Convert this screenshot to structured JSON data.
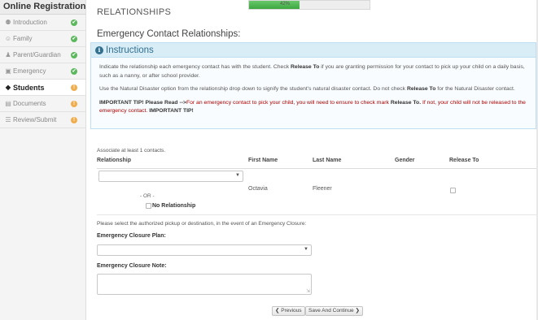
{
  "sidebar": {
    "title": "Online Registration",
    "items": [
      {
        "label": "Introduction",
        "icon": "lightbulb-icon",
        "glyph": "⚉",
        "status": "complete",
        "status_glyph": "✔"
      },
      {
        "label": "Family",
        "icon": "users-icon",
        "glyph": "☺",
        "status": "complete",
        "status_glyph": "✔"
      },
      {
        "label": "Parent/Guardian",
        "icon": "user-icon",
        "glyph": "♟",
        "status": "complete",
        "status_glyph": "✔"
      },
      {
        "label": "Emergency",
        "icon": "ambulance-icon",
        "glyph": "▣",
        "status": "complete",
        "status_glyph": "✔"
      },
      {
        "label": "Students",
        "icon": "graduation-cap-icon",
        "glyph": "◆",
        "status": "warning",
        "status_glyph": "!"
      },
      {
        "label": "Documents",
        "icon": "document-icon",
        "glyph": "▤",
        "status": "warning",
        "status_glyph": "!"
      },
      {
        "label": "Review/Submit",
        "icon": "list-icon",
        "glyph": "☰",
        "status": "warning",
        "status_glyph": "!"
      }
    ],
    "active_index": 4
  },
  "header": {
    "title": "RELATIONSHIPS",
    "progress_percent": 42,
    "progress_label": "42%"
  },
  "section_heading": "Emergency Contact Relationships:",
  "instructions": {
    "heading": "Instructions",
    "icon": "info-icon",
    "p1_a": "Indicate the relationship each emergency contact has with the student. Check ",
    "p1_b": "Release To",
    "p1_c": " if you are granting permission for your contact to pick up your child on a daily basis, such as a nanny, or after school provider.",
    "p2_a": "Use the Natural Disaster option from the relationship drop down to signify the student's natural disaster contact. Do not check ",
    "p2_b": "Release To",
    "p2_c": " for the Natural Disaster contact.",
    "p3_a": "IMPORTANT TIP! Please Read -->",
    "p3_b": "For an emergency contact to pick your child, you will need to ensure to check mark ",
    "p3_c": "Release To.",
    "p3_d": " If not, your child will not be released to the emergency contact. ",
    "p3_e": "IMPORTANT TIP!"
  },
  "contacts": {
    "associate_text": "Associate at least 1 contacts.",
    "columns": [
      "Relationship",
      "First Name",
      "Last Name",
      "Gender",
      "Release To"
    ],
    "rows": [
      {
        "relationship": "",
        "first_name": "Octavia",
        "last_name": "Fleener",
        "gender": "",
        "release_to": false
      }
    ],
    "or_text": "- OR -",
    "no_relationship_label": "No Relationship"
  },
  "closure": {
    "question": "Please select the authorized pickup or destination, in the event of an Emergency Closure:",
    "plan_label": "Emergency Closure Plan:",
    "plan_value": "",
    "note_label": "Emergency Closure Note:",
    "note_value": ""
  },
  "footer": {
    "previous_label": "❮ Previous",
    "continue_label": "Save And Continue ❯"
  },
  "colors": {
    "progress": "#4cae4c",
    "info": "#31708f",
    "info_bg": "#d9edf7",
    "important": "#b00000",
    "complete": "#5cb85c",
    "warning": "#f0ad4e"
  }
}
